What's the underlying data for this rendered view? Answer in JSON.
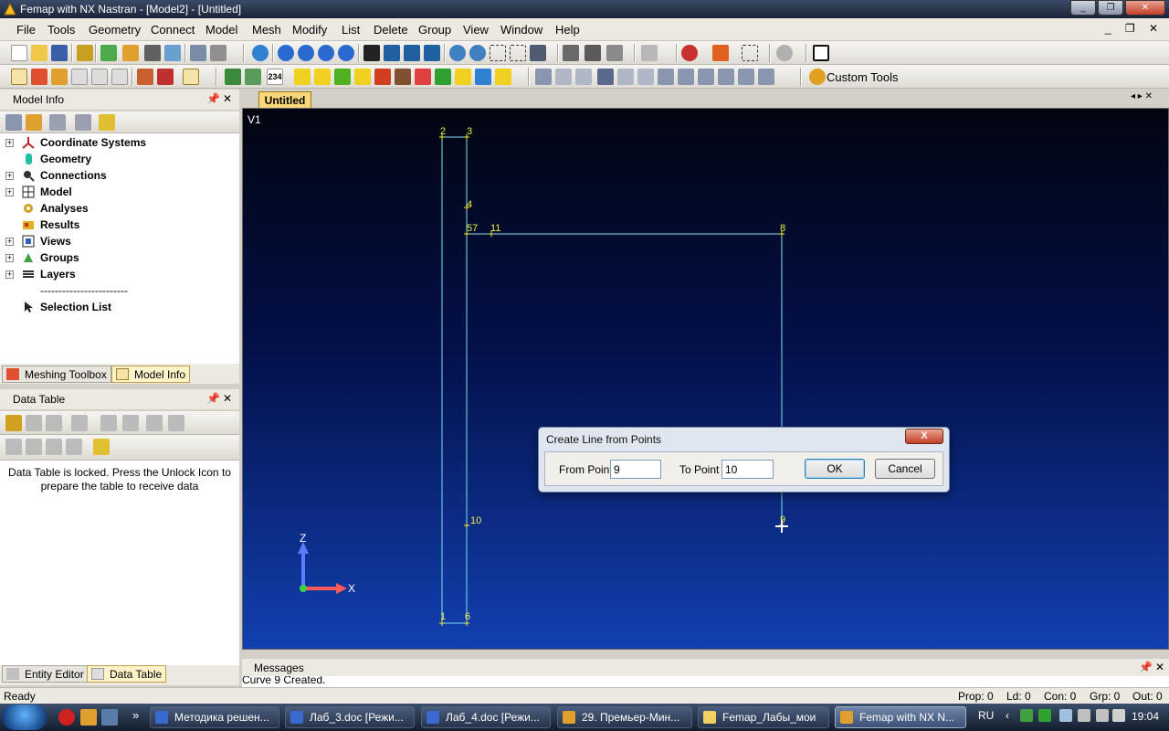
{
  "window": {
    "title": "Femap with NX Nastran - [Model2] - [Untitled]"
  },
  "menu": [
    "File",
    "Tools",
    "Geometry",
    "Connect",
    "Model",
    "Mesh",
    "Modify",
    "List",
    "Delete",
    "Group",
    "View",
    "Window",
    "Help"
  ],
  "toolbar": {
    "custom_tools_label": "Custom Tools"
  },
  "model_info": {
    "title": "Model Info",
    "items": [
      {
        "label": "Coordinate Systems",
        "icon": "axes-icon"
      },
      {
        "label": "Geometry",
        "icon": "cylinder-icon"
      },
      {
        "label": "Connections",
        "icon": "magnifier-icon"
      },
      {
        "label": "Model",
        "icon": "grid-icon"
      },
      {
        "label": "Analyses",
        "icon": "gear-icon"
      },
      {
        "label": "Results",
        "icon": "results-icon"
      },
      {
        "label": "Views",
        "icon": "view-icon"
      },
      {
        "label": "Groups",
        "icon": "group-icon"
      },
      {
        "label": "Layers",
        "icon": "layers-icon"
      }
    ],
    "separator": "------------------------",
    "selection_list": "Selection List"
  },
  "left_tabs": [
    "Meshing Toolbox",
    "Model Info"
  ],
  "data_table": {
    "title": "Data Table",
    "message": "Data Table is locked. Press the Unlock Icon to prepare the table to receive data"
  },
  "bottom_tabs": [
    "Entity Editor",
    "Data Table"
  ],
  "viewport": {
    "tab": "Untitled",
    "view_label": "V1",
    "point_labels": [
      "2",
      "3",
      "4",
      "57",
      "11",
      "8",
      "10",
      "9",
      "1",
      "6"
    ],
    "axis_labels": [
      "Z",
      "X"
    ]
  },
  "dialog": {
    "title": "Create Line from Points",
    "close": "X",
    "from_label": "From Point",
    "from_value": "9",
    "to_label": "To Point",
    "to_value": "10",
    "ok": "OK",
    "cancel": "Cancel"
  },
  "messages": {
    "title": "Messages",
    "last_line": "Curve 9 Created."
  },
  "status": {
    "text": "Ready",
    "prop": "Prop: 0",
    "ld": "Ld: 0",
    "con": "Con: 0",
    "grp": "Grp: 0",
    "out": "Out: 0"
  },
  "taskbar": {
    "more": "»",
    "tasks": [
      "Методика решен...",
      "Лаб_3.doc [Режи...",
      "Лаб_4.doc [Режи...",
      "29. Премьер-Мин...",
      "Femap_Лабы_мои",
      "Femap with NX N..."
    ],
    "lang": "RU",
    "time": "19:04"
  },
  "colors": {
    "geometry_line": "#7fe0f0",
    "point_label": "#f0f040",
    "viewport_top": "#020510",
    "viewport_bottom": "#1240b0"
  }
}
